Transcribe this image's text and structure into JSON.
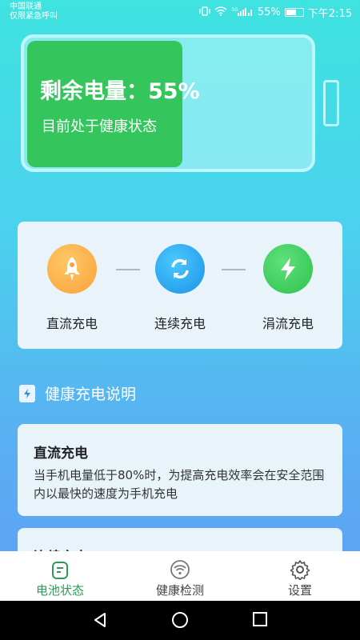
{
  "status_bar": {
    "carrier": "中国联通",
    "emergency": "仅限紧急呼叫",
    "battery_percent": "55%",
    "time": "下午2:15"
  },
  "battery": {
    "title": "剩余电量：55%",
    "subtitle": "目前处于健康状态",
    "level": 0.55,
    "fill_color": "#34c65d"
  },
  "modes": [
    {
      "label": "直流充电",
      "icon": "rocket-icon",
      "color": "#f9a23a"
    },
    {
      "label": "连续充电",
      "icon": "refresh-icon",
      "color": "#1c93e6"
    },
    {
      "label": "涓流充电",
      "icon": "lightning-icon",
      "color": "#2ec24f"
    }
  ],
  "section": {
    "title": "健康充电说明",
    "icon": "battery-doc-icon"
  },
  "info_cards": [
    {
      "title": "直流充电",
      "body": "当手机电量低于80%时，为提高充电效率会在安全范围内以最快的速度为手机充电"
    },
    {
      "title": "连续充电",
      "body": ""
    }
  ],
  "bottom_nav": {
    "items": [
      {
        "label": "电池状态",
        "icon": "battery-status-icon",
        "active": true
      },
      {
        "label": "健康检测",
        "icon": "wifi-check-icon",
        "active": false
      },
      {
        "label": "设置",
        "icon": "gear-icon",
        "active": false
      }
    ],
    "active_color": "#2c9a58"
  },
  "system_nav": {
    "icons": [
      "back-icon",
      "home-icon",
      "recents-icon"
    ]
  }
}
